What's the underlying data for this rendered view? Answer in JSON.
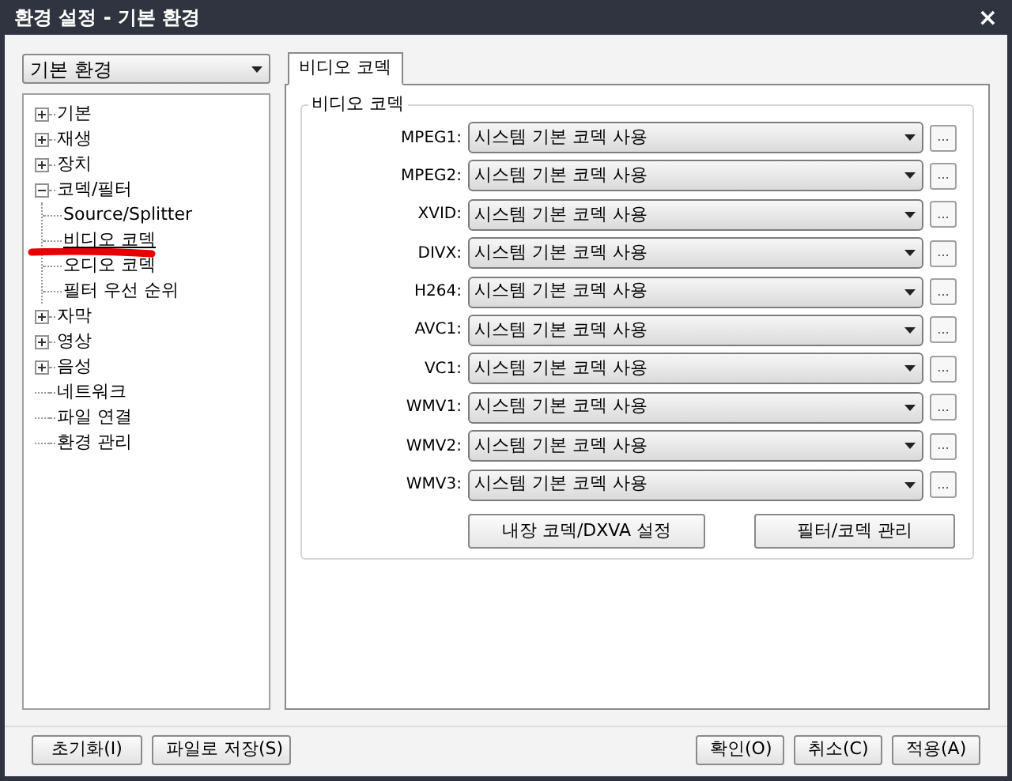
{
  "window": {
    "title": "환경 설정 - 기본 환경",
    "close": "×"
  },
  "profile": {
    "value": "기본 환경"
  },
  "tree": [
    {
      "label": "기본",
      "kind": "folder",
      "expanded": false
    },
    {
      "label": "재생",
      "kind": "folder",
      "expanded": false
    },
    {
      "label": "장치",
      "kind": "folder",
      "expanded": false
    },
    {
      "label": "코덱/필터",
      "kind": "folder",
      "expanded": true,
      "children": [
        {
          "label": "Source/Splitter",
          "selected": false
        },
        {
          "label": "비디오 코덱",
          "selected": true
        },
        {
          "label": "오디오 코덱",
          "selected": false
        },
        {
          "label": "필터 우선 순위",
          "selected": false
        }
      ]
    },
    {
      "label": "자막",
      "kind": "folder",
      "expanded": false
    },
    {
      "label": "영상",
      "kind": "folder",
      "expanded": false
    },
    {
      "label": "음성",
      "kind": "folder",
      "expanded": false
    },
    {
      "label": "네트워크",
      "kind": "leaf"
    },
    {
      "label": "파일 연결",
      "kind": "leaf"
    },
    {
      "label": "환경 관리",
      "kind": "leaf"
    }
  ],
  "tabs": [
    {
      "label": "비디오 코덱",
      "selected": true
    }
  ],
  "group": {
    "title": "비디오 코덱",
    "rows": [
      {
        "label": "MPEG1:",
        "value": "시스템 기본 코덱 사용",
        "more": "..."
      },
      {
        "label": "MPEG2:",
        "value": "시스템 기본 코덱 사용",
        "more": "..."
      },
      {
        "label": "XVID:",
        "value": "시스템 기본 코덱 사용",
        "more": "..."
      },
      {
        "label": "DIVX:",
        "value": "시스템 기본 코덱 사용",
        "more": "..."
      },
      {
        "label": "H264:",
        "value": "시스템 기본 코덱 사용",
        "more": "..."
      },
      {
        "label": "AVC1:",
        "value": "시스템 기본 코덱 사용",
        "more": "..."
      },
      {
        "label": "VC1:",
        "value": "시스템 기본 코덱 사용",
        "more": "..."
      },
      {
        "label": "WMV1:",
        "value": "시스템 기본 코덱 사용",
        "more": "..."
      },
      {
        "label": "WMV2:",
        "value": "시스템 기본 코덱 사용",
        "more": "..."
      },
      {
        "label": "WMV3:",
        "value": "시스템 기본 코덱 사용",
        "more": "..."
      }
    ],
    "buttons": [
      "내장 코덱/DXVA 설정",
      "필터/코덱 관리"
    ]
  },
  "footer": {
    "left": [
      "초기화(I)",
      "파일로 저장(S)"
    ],
    "right": [
      "확인(O)",
      "취소(C)",
      "적용(A)"
    ]
  },
  "annotation": {
    "kind": "marker-underline"
  }
}
